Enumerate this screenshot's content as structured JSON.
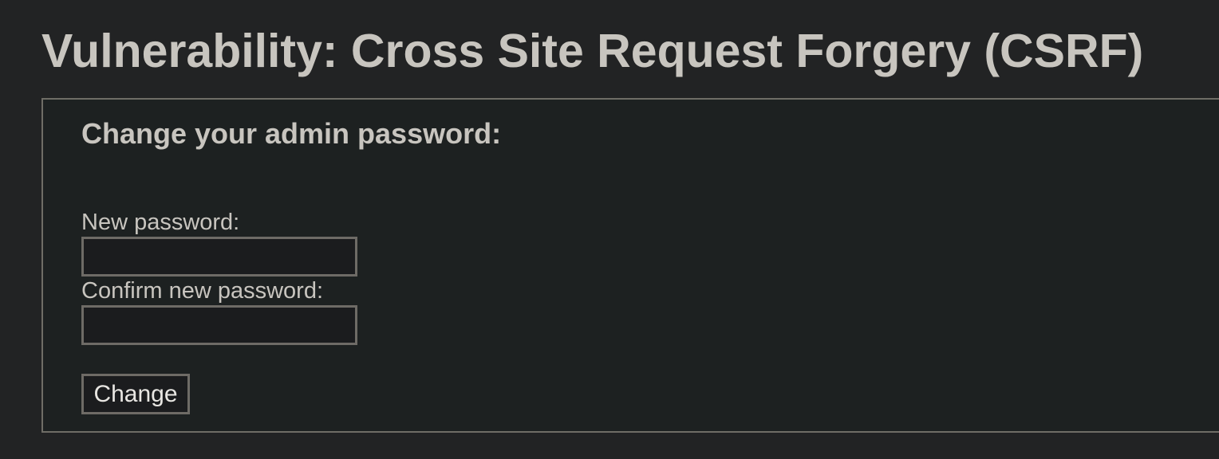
{
  "page": {
    "title": "Vulnerability: Cross Site Request Forgery (CSRF)"
  },
  "form": {
    "heading": "Change your admin password:",
    "new_password_label": "New password:",
    "new_password_value": "",
    "confirm_password_label": "Confirm new password:",
    "confirm_password_value": "",
    "submit_label": "Change"
  },
  "colors": {
    "page_background": "#222324",
    "panel_background": "#1d2121",
    "panel_border": "#6f6d66",
    "text": "#c8c5bf",
    "input_background": "#1b1c1e",
    "input_border": "#6e6b66"
  }
}
